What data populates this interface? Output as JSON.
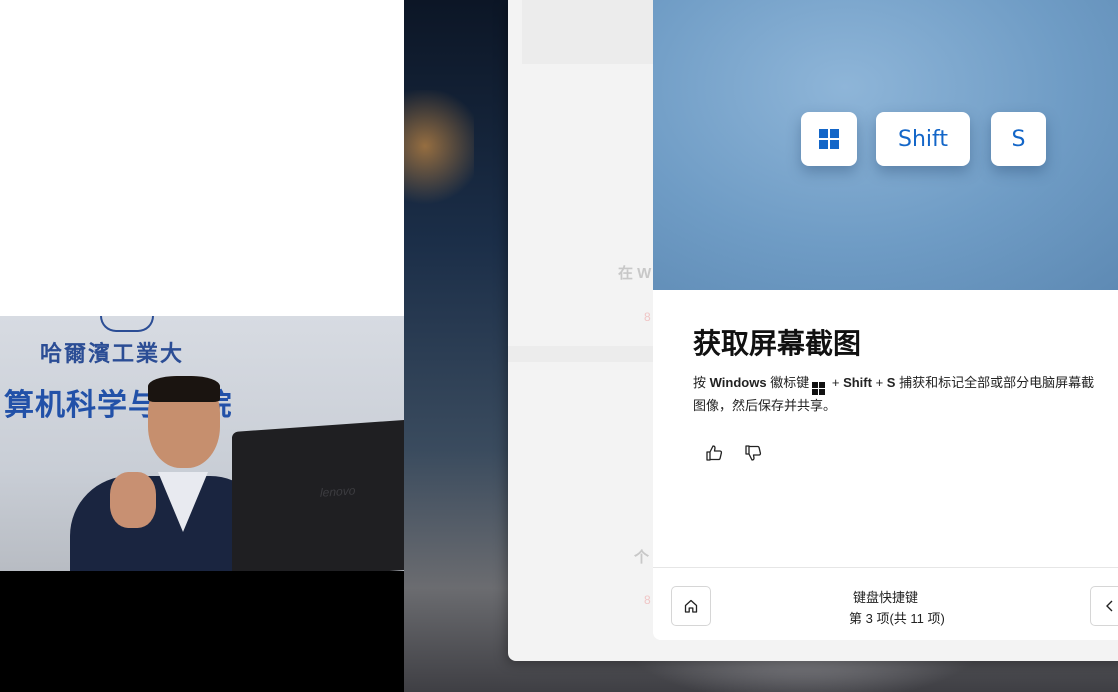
{
  "video": {
    "sign_line1": "哈爾濱工業大",
    "sign_line2": "算机科学与技  院",
    "monitor_brand": "lenovo"
  },
  "background_window": {
    "heading_fragment": "在 W",
    "red_fragment_1": "8",
    "subheading_fragment": "个",
    "red_fragment_2": "8"
  },
  "tip_card": {
    "keys": {
      "shift_label": "Shift",
      "s_label": "S"
    },
    "title": "获取屏幕截图",
    "desc": {
      "prefix": "按",
      "windows": "Windows",
      "logo_key": "徽标键",
      "plus1": "+",
      "shift": "Shift",
      "plus2": "+",
      "s": "S",
      "rest_line1": "捕获和标记全部或部分电脑屏幕截",
      "line2": "图像，然后保存并共享。"
    },
    "footer": {
      "title": "键盘快捷键",
      "count": "第 3 项(共 11 项)"
    }
  },
  "colors": {
    "accent": "#1366c8",
    "hero_blue": "#6f9cc5"
  }
}
